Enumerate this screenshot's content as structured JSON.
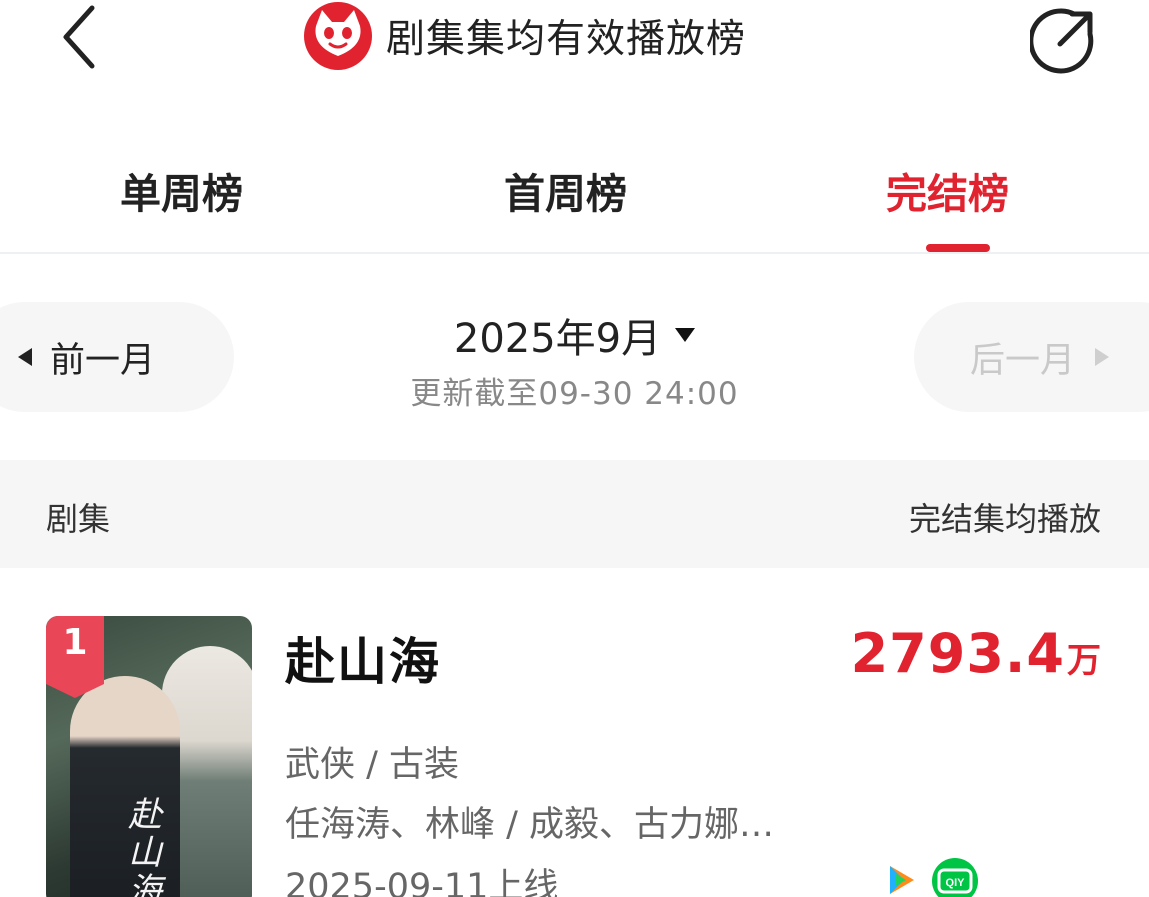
{
  "header": {
    "title": "剧集集均有效播放榜",
    "back_icon": "chevron-left-icon",
    "logo_icon": "cat-logo-icon",
    "share_icon": "share-arrow-icon",
    "brand_color": "#e0232f"
  },
  "tabs": [
    {
      "label": "单周榜",
      "active": false
    },
    {
      "label": "首周榜",
      "active": false
    },
    {
      "label": "完结榜",
      "active": true
    }
  ],
  "month_nav": {
    "prev_label": "前一月",
    "next_label": "后一月",
    "current_month": "2025年9月",
    "update_text": "更新截至09-30  24:00"
  },
  "columns": {
    "left": "剧集",
    "right": "完结集均播放"
  },
  "rows": [
    {
      "rank": "1",
      "title": "赴山海",
      "genre": "武侠 / 古装",
      "cast": "任海涛、林峰 / 成毅、古力娜…",
      "release": "2025-09-11上线",
      "play_value": "2793.4",
      "play_unit": "万",
      "poster_text": "赴山海",
      "platforms": [
        "tencent-video-icon",
        "iqiyi-icon"
      ]
    }
  ]
}
